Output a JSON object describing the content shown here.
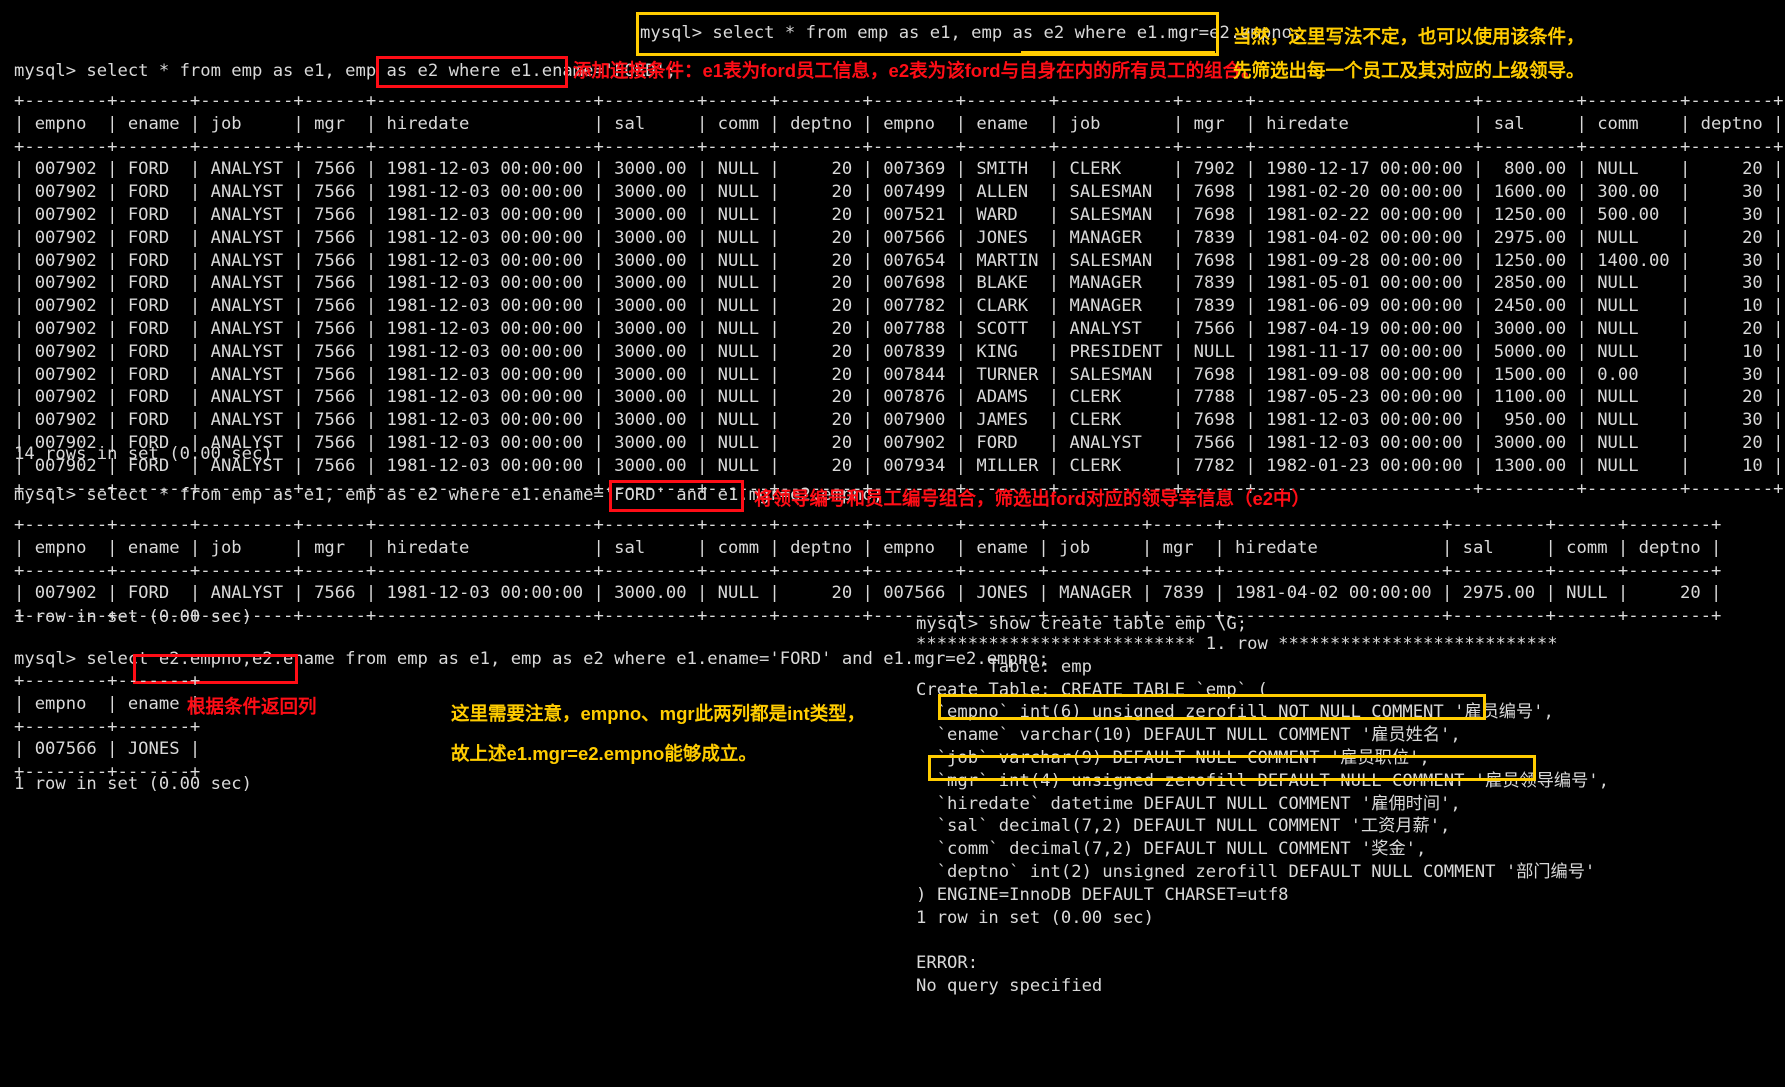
{
  "terminal": {
    "prompt": "mysql> ",
    "queries": {
      "q1": "mysql> select * from emp as e1, emp as e2 where e1.ename='FORD';",
      "q1_boxed": "where e1.ename='FORD'",
      "q2": "mysql> select * from emp as e1, emp as e2 where e1.ename='FORD' and e1.mgr=e2.empno;",
      "q2_boxed": "e1.mgr=e2.empno",
      "q3": "mysql> select e2.empno,e2.ename from emp as e1, emp as e2 where e1.ename='FORD' and e1.mgr=e2.empno;",
      "q3_boxed": "e2.empno,e2.ename",
      "q_float": "mysql> select * from emp as e1, emp as e2 where e1.mgr=e2.empno;",
      "q_float_underlined": "e1.mgr=e2.empno;",
      "q4": "mysql> show create table emp \\G;"
    },
    "status": {
      "rows14": "14 rows in set (0.00 sec)",
      "rows1_a": "1 row in set (0.00 sec)",
      "rows1_b": "1 row in set (0.00 sec)",
      "rows1_c": "1 row in set (0.00 sec)"
    },
    "table1": {
      "headers": [
        "empno",
        "ename",
        "job",
        "mgr",
        "hiredate",
        "sal",
        "comm",
        "deptno",
        "empno",
        "ename",
        "job",
        "mgr",
        "hiredate",
        "sal",
        "comm",
        "deptno"
      ],
      "rows": [
        [
          "007902",
          "FORD",
          "ANALYST",
          "7566",
          "1981-12-03 00:00:00",
          "3000.00",
          "NULL",
          "20",
          "007369",
          "SMITH",
          "CLERK",
          "7902",
          "1980-12-17 00:00:00",
          "800.00",
          "NULL",
          "20"
        ],
        [
          "007902",
          "FORD",
          "ANALYST",
          "7566",
          "1981-12-03 00:00:00",
          "3000.00",
          "NULL",
          "20",
          "007499",
          "ALLEN",
          "SALESMAN",
          "7698",
          "1981-02-20 00:00:00",
          "1600.00",
          "300.00",
          "30"
        ],
        [
          "007902",
          "FORD",
          "ANALYST",
          "7566",
          "1981-12-03 00:00:00",
          "3000.00",
          "NULL",
          "20",
          "007521",
          "WARD",
          "SALESMAN",
          "7698",
          "1981-02-22 00:00:00",
          "1250.00",
          "500.00",
          "30"
        ],
        [
          "007902",
          "FORD",
          "ANALYST",
          "7566",
          "1981-12-03 00:00:00",
          "3000.00",
          "NULL",
          "20",
          "007566",
          "JONES",
          "MANAGER",
          "7839",
          "1981-04-02 00:00:00",
          "2975.00",
          "NULL",
          "20"
        ],
        [
          "007902",
          "FORD",
          "ANALYST",
          "7566",
          "1981-12-03 00:00:00",
          "3000.00",
          "NULL",
          "20",
          "007654",
          "MARTIN",
          "SALESMAN",
          "7698",
          "1981-09-28 00:00:00",
          "1250.00",
          "1400.00",
          "30"
        ],
        [
          "007902",
          "FORD",
          "ANALYST",
          "7566",
          "1981-12-03 00:00:00",
          "3000.00",
          "NULL",
          "20",
          "007698",
          "BLAKE",
          "MANAGER",
          "7839",
          "1981-05-01 00:00:00",
          "2850.00",
          "NULL",
          "30"
        ],
        [
          "007902",
          "FORD",
          "ANALYST",
          "7566",
          "1981-12-03 00:00:00",
          "3000.00",
          "NULL",
          "20",
          "007782",
          "CLARK",
          "MANAGER",
          "7839",
          "1981-06-09 00:00:00",
          "2450.00",
          "NULL",
          "10"
        ],
        [
          "007902",
          "FORD",
          "ANALYST",
          "7566",
          "1981-12-03 00:00:00",
          "3000.00",
          "NULL",
          "20",
          "007788",
          "SCOTT",
          "ANALYST",
          "7566",
          "1987-04-19 00:00:00",
          "3000.00",
          "NULL",
          "20"
        ],
        [
          "007902",
          "FORD",
          "ANALYST",
          "7566",
          "1981-12-03 00:00:00",
          "3000.00",
          "NULL",
          "20",
          "007839",
          "KING",
          "PRESIDENT",
          "NULL",
          "1981-11-17 00:00:00",
          "5000.00",
          "NULL",
          "10"
        ],
        [
          "007902",
          "FORD",
          "ANALYST",
          "7566",
          "1981-12-03 00:00:00",
          "3000.00",
          "NULL",
          "20",
          "007844",
          "TURNER",
          "SALESMAN",
          "7698",
          "1981-09-08 00:00:00",
          "1500.00",
          "0.00",
          "30"
        ],
        [
          "007902",
          "FORD",
          "ANALYST",
          "7566",
          "1981-12-03 00:00:00",
          "3000.00",
          "NULL",
          "20",
          "007876",
          "ADAMS",
          "CLERK",
          "7788",
          "1987-05-23 00:00:00",
          "1100.00",
          "NULL",
          "20"
        ],
        [
          "007902",
          "FORD",
          "ANALYST",
          "7566",
          "1981-12-03 00:00:00",
          "3000.00",
          "NULL",
          "20",
          "007900",
          "JAMES",
          "CLERK",
          "7698",
          "1981-12-03 00:00:00",
          "950.00",
          "NULL",
          "30"
        ],
        [
          "007902",
          "FORD",
          "ANALYST",
          "7566",
          "1981-12-03 00:00:00",
          "3000.00",
          "NULL",
          "20",
          "007902",
          "FORD",
          "ANALYST",
          "7566",
          "1981-12-03 00:00:00",
          "3000.00",
          "NULL",
          "20"
        ],
        [
          "007902",
          "FORD",
          "ANALYST",
          "7566",
          "1981-12-03 00:00:00",
          "3000.00",
          "NULL",
          "20",
          "007934",
          "MILLER",
          "CLERK",
          "7782",
          "1982-01-23 00:00:00",
          "1300.00",
          "NULL",
          "10"
        ]
      ]
    },
    "table2": {
      "headers": [
        "empno",
        "ename",
        "job",
        "mgr",
        "hiredate",
        "sal",
        "comm",
        "deptno",
        "empno",
        "ename",
        "job",
        "mgr",
        "hiredate",
        "sal",
        "comm",
        "deptno"
      ],
      "rows": [
        [
          "007902",
          "FORD",
          "ANALYST",
          "7566",
          "1981-12-03 00:00:00",
          "3000.00",
          "NULL",
          "20",
          "007566",
          "JONES",
          "MANAGER",
          "7839",
          "1981-04-02 00:00:00",
          "2975.00",
          "NULL",
          "20"
        ]
      ]
    },
    "table3": {
      "headers": [
        "empno",
        "ename"
      ],
      "rows": [
        [
          "007566",
          "JONES"
        ]
      ]
    },
    "create_table": {
      "star_line": "*************************** 1. row ***************************",
      "table_label": "       Table: emp",
      "create_label": "Create Table: CREATE TABLE `emp` (",
      "cols": [
        "  `empno` int(6) unsigned zerofill NOT NULL COMMENT '雇员编号',",
        "  `ename` varchar(10) DEFAULT NULL COMMENT '雇员姓名',",
        "  `job` varchar(9) DEFAULT NULL COMMENT '雇员职位',",
        "  `mgr` int(4) unsigned zerofill DEFAULT NULL COMMENT '雇员领导编号',",
        "  `hiredate` datetime DEFAULT NULL COMMENT '雇佣时间',",
        "  `sal` decimal(7,2) DEFAULT NULL COMMENT '工资月薪',",
        "  `comm` decimal(7,2) DEFAULT NULL COMMENT '奖金',",
        "  `deptno` int(2) unsigned zerofill DEFAULT NULL COMMENT '部门编号'"
      ],
      "engine": ") ENGINE=InnoDB DEFAULT CHARSET=utf8",
      "error_label": "ERROR:",
      "error_msg": "No query specified"
    }
  },
  "annotations": {
    "red_1": "添加连接条件：e1表为ford员工信息，e2表为该ford与自身在内的所有员工的组合。",
    "yellow_1_line1": "当然，这里写法不定，也可以使用该条件，",
    "yellow_1_line2": "先筛选出每一个员工及其对应的上级领导。",
    "red_2": "将领导编号和员工编号组合，筛选出ford对应的领导幸信息（e2中）",
    "red_3": "根据条件返回列",
    "yellow_2_line1": "这里需要注意，empno、mgr此两列都是int类型，",
    "yellow_2_line2": "故上述e1.mgr=e2.empno能够成立。"
  },
  "colors": {
    "background": "#000000",
    "terminal_text": "#d9d9d9",
    "highlight_red": "#ff0d16",
    "highlight_yellow": "#ffcc00"
  }
}
